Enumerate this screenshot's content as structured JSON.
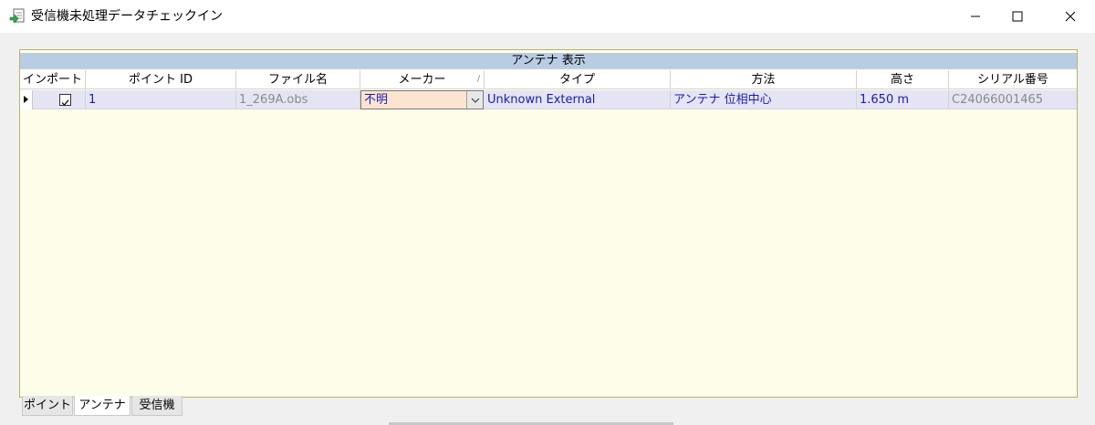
{
  "window": {
    "title": "受信機未処理データチェックイン",
    "minimize_icon": "minimize-icon",
    "maximize_icon": "maximize-icon",
    "close_icon": "close-icon"
  },
  "grid": {
    "group_header": "アンテナ 表示",
    "columns": [
      {
        "key": "import",
        "label": "インポート"
      },
      {
        "key": "point_id",
        "label": "ポイント ID"
      },
      {
        "key": "file_name",
        "label": "ファイル名"
      },
      {
        "key": "maker",
        "label": "メーカー"
      },
      {
        "key": "type",
        "label": "タイプ"
      },
      {
        "key": "method",
        "label": "方法"
      },
      {
        "key": "height",
        "label": "高さ"
      },
      {
        "key": "serial",
        "label": "シリアル番号"
      }
    ],
    "rows": [
      {
        "import": true,
        "point_id": "1",
        "file_name": "1_269A.obs",
        "maker": "不明",
        "type": "Unknown External",
        "method": "アンテナ 位相中心",
        "height": "1.650 m",
        "serial": "C24066001465"
      }
    ]
  },
  "tabs": [
    {
      "label": "ポイント",
      "active": false
    },
    {
      "label": "アンテナ",
      "active": true
    },
    {
      "label": "受信機",
      "active": false
    }
  ]
}
